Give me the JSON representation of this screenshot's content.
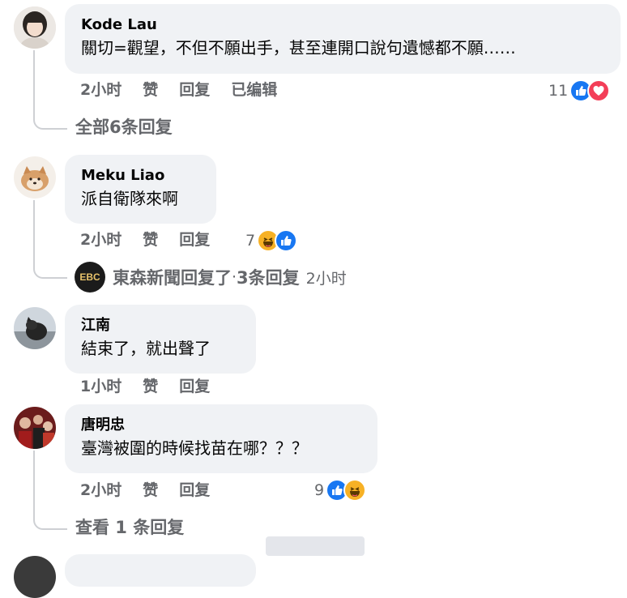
{
  "comments": [
    {
      "author": "Kode Lau",
      "text": "關切=觀望，不但不願出手，甚至連開口說句遺憾都不願……",
      "time": "2小时",
      "like_label": "赞",
      "reply_label": "回复",
      "edited_label": "已编辑",
      "reaction_count": "11",
      "reactions": [
        "like-icon",
        "love-icon"
      ],
      "replies_link": "全部6条回复"
    },
    {
      "author": "Meku Liao",
      "text": "派自衛隊來啊",
      "time": "2小时",
      "like_label": "赞",
      "reply_label": "回复",
      "reaction_count": "7",
      "reactions": [
        "haha-icon",
        "like-icon"
      ],
      "page_reply": {
        "avatar_text": "EBC",
        "name": "東森新聞回复了",
        "sep": " · ",
        "count": "3条回复",
        "time": "2小时"
      }
    },
    {
      "author": "江南",
      "text": "結束了，就出聲了",
      "time": "1小时",
      "like_label": "赞",
      "reply_label": "回复"
    },
    {
      "author": "唐明忠",
      "text": "臺灣被圍的時候找苗在哪？？？",
      "time": "2小时",
      "like_label": "赞",
      "reply_label": "回复",
      "reaction_count": "9",
      "reactions": [
        "like-icon",
        "haha-icon"
      ],
      "replies_link": "查看 1 条回复"
    }
  ],
  "colors": {
    "bubble": "#f0f2f5",
    "secondary_text": "#65676b",
    "like": "#1877f2",
    "love": "#f33e58",
    "haha": "#f7b125"
  }
}
